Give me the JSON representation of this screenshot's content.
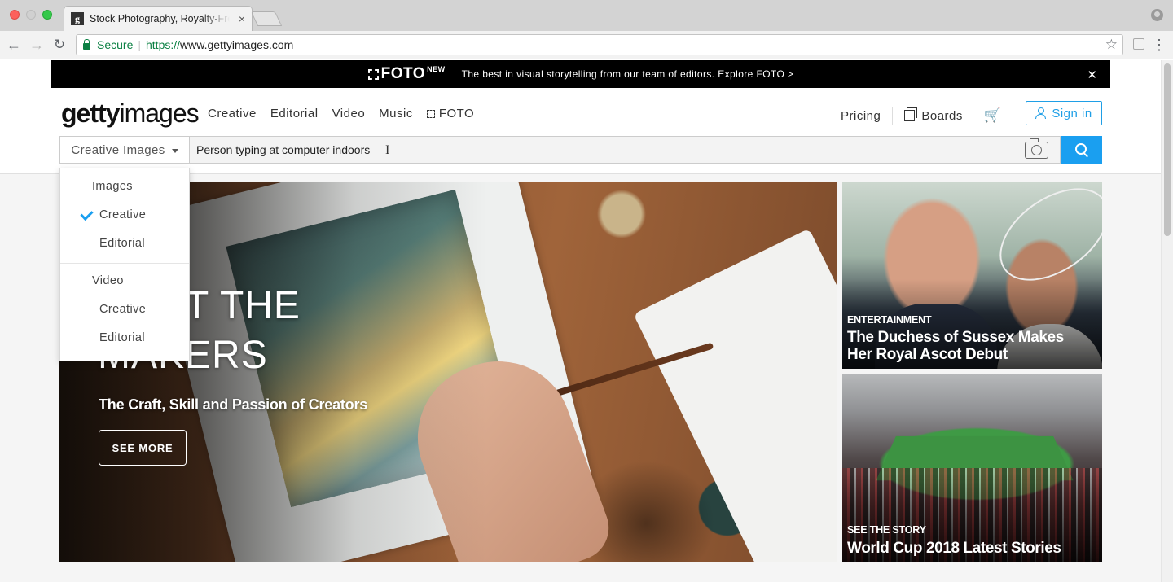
{
  "browser": {
    "tab_title": "Stock Photography, Royalty-Free",
    "tab_close": "×",
    "favicon_letter": "g",
    "secure_label": "Secure",
    "url_scheme": "https://",
    "url_rest": "www.gettyimages.com",
    "back_icon": "←",
    "forward_icon": "→",
    "reload_icon": "↻",
    "star_icon": "☆",
    "menu_icon": "⋮"
  },
  "promo": {
    "brand": "FOTO",
    "badge": "NEW",
    "text": "The best in visual storytelling from our team of editors. Explore FOTO  >",
    "close": "✕"
  },
  "logo": {
    "bold": "getty",
    "light": "images"
  },
  "nav": {
    "items": [
      "Creative",
      "Editorial",
      "Video",
      "Music",
      "FOTO"
    ],
    "pricing": "Pricing",
    "boards": "Boards",
    "cart_icon": "🛒",
    "sign_in": "Sign in"
  },
  "search": {
    "type_label": "Creative Images",
    "query": "Person typing at computer indoors",
    "text_cursor": "I"
  },
  "dropdown": {
    "groups": [
      {
        "label": "Images",
        "items": [
          "Creative",
          "Editorial"
        ]
      },
      {
        "label": "Video",
        "items": [
          "Creative",
          "Editorial"
        ]
      }
    ],
    "selected": "Images / Creative"
  },
  "hero": {
    "headline": "MEET THE\nMAKERS",
    "subtitle": "The Craft, Skill and Passion of Creators",
    "button": "SEE MORE"
  },
  "cards": [
    {
      "kicker": "ENTERTAINMENT",
      "title": "The Duchess of Sussex Makes Her Royal Ascot Debut"
    },
    {
      "kicker": "SEE THE STORY",
      "title": "World Cup 2018 Latest Stories"
    }
  ],
  "colors": {
    "accent": "#1a9ff0",
    "secure_green": "#0b8043",
    "promo_bg": "#000000"
  }
}
